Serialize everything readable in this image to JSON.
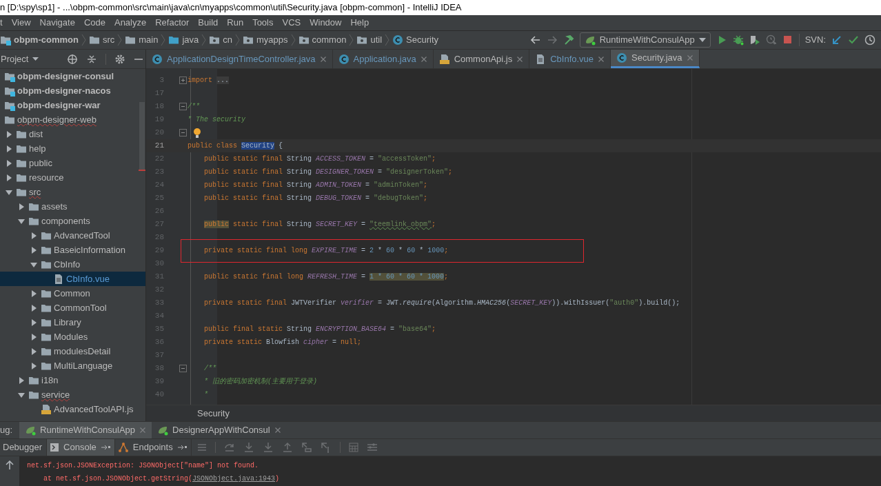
{
  "window": {
    "title": "n [D:\\spy\\sp1] - ...\\obpm-common\\src\\main\\java\\cn\\myapps\\common\\util\\Security.java [obpm-common] - IntelliJ IDEA"
  },
  "menu": [
    "t",
    "View",
    "Navigate",
    "Code",
    "Analyze",
    "Refactor",
    "Build",
    "Run",
    "Tools",
    "VCS",
    "Window",
    "Help"
  ],
  "breadcrumbs": [
    {
      "label": "obpm-common",
      "kind": "module"
    },
    {
      "label": "src",
      "kind": "folder"
    },
    {
      "label": "main",
      "kind": "folder"
    },
    {
      "label": "java",
      "kind": "source"
    },
    {
      "label": "cn",
      "kind": "package"
    },
    {
      "label": "myapps",
      "kind": "package"
    },
    {
      "label": "common",
      "kind": "package"
    },
    {
      "label": "util",
      "kind": "package"
    },
    {
      "label": "Security",
      "kind": "class"
    }
  ],
  "run_config": "RuntimeWithConsulApp",
  "svn_label": "SVN:",
  "project_panel": {
    "title": "Project",
    "tree": [
      {
        "label": "obpm-designer-consul",
        "kind": "module",
        "error": false,
        "selected": false
      },
      {
        "label": "obpm-designer-nacos",
        "kind": "module",
        "error": false,
        "selected": false
      },
      {
        "label": "obpm-designer-war",
        "kind": "module",
        "error": false,
        "selected": false
      },
      {
        "label": "obpm-designer-web",
        "kind": "folder",
        "error": true,
        "selected": false,
        "children": [
          {
            "label": "dist",
            "kind": "folder",
            "error": false,
            "selected": false,
            "expanded": false
          },
          {
            "label": "help",
            "kind": "folder",
            "error": false,
            "selected": false,
            "expanded": false
          },
          {
            "label": "public",
            "kind": "folder",
            "error": false,
            "selected": false,
            "expanded": false
          },
          {
            "label": "resource",
            "kind": "folder",
            "error": false,
            "selected": false,
            "expanded": false
          },
          {
            "label": "src",
            "kind": "folder",
            "error": true,
            "selected": false,
            "expanded": true,
            "children": [
              {
                "label": "assets",
                "kind": "folder",
                "error": false,
                "selected": false,
                "expanded": false
              },
              {
                "label": "components",
                "kind": "folder",
                "error": false,
                "selected": false,
                "expanded": true,
                "children": [
                  {
                    "label": "AdvancedTool",
                    "kind": "folder",
                    "error": false,
                    "selected": false,
                    "expanded": false
                  },
                  {
                    "label": "BaseicInformation",
                    "kind": "folder",
                    "error": false,
                    "selected": false,
                    "expanded": false
                  },
                  {
                    "label": "CbInfo",
                    "kind": "folder",
                    "error": false,
                    "selected": false,
                    "expanded": true,
                    "children": [
                      {
                        "label": "CbInfo.vue",
                        "kind": "vue",
                        "error": false,
                        "selected": true
                      }
                    ]
                  },
                  {
                    "label": "Common",
                    "kind": "folder",
                    "error": false,
                    "selected": false,
                    "expanded": false
                  },
                  {
                    "label": "CommonTool",
                    "kind": "folder",
                    "error": false,
                    "selected": false,
                    "expanded": false
                  },
                  {
                    "label": "Library",
                    "kind": "folder",
                    "error": false,
                    "selected": false,
                    "expanded": false
                  },
                  {
                    "label": "Modules",
                    "kind": "folder",
                    "error": false,
                    "selected": false,
                    "expanded": false
                  },
                  {
                    "label": "modulesDetail",
                    "kind": "folder",
                    "error": false,
                    "selected": false,
                    "expanded": false
                  },
                  {
                    "label": "MultiLanguage",
                    "kind": "folder",
                    "error": false,
                    "selected": false,
                    "expanded": false
                  }
                ]
              },
              {
                "label": "i18n",
                "kind": "folder",
                "error": false,
                "selected": false,
                "expanded": false
              },
              {
                "label": "service",
                "kind": "folder",
                "error": true,
                "selected": false,
                "expanded": true,
                "children": [
                  {
                    "label": "AdvancedToolAPI.js",
                    "kind": "js",
                    "error": false,
                    "selected": false
                  }
                ]
              }
            ]
          }
        ]
      }
    ]
  },
  "editor_tabs": [
    {
      "label": "ApplicationDesignTimeController.java",
      "kind": "class",
      "modified": true,
      "selected": false
    },
    {
      "label": "Application.java",
      "kind": "class",
      "modified": true,
      "selected": false
    },
    {
      "label": "CommonApi.js",
      "kind": "js",
      "modified": false,
      "selected": false
    },
    {
      "label": "CbInfo.vue",
      "kind": "file",
      "modified": true,
      "selected": false
    },
    {
      "label": "Security.java",
      "kind": "class",
      "modified": false,
      "selected": true
    }
  ],
  "code_lines": [
    {
      "number": "3",
      "fold_marker": true,
      "indented": false,
      "tokens": [
        {
          "text": "import",
          "kind": "kw"
        },
        {
          "text": "...",
          "kind": "folded"
        }
      ]
    },
    {
      "number": "17"
    },
    {
      "number": "18",
      "fold_marker": true,
      "indented": false,
      "tokens": [
        {
          "text": "/**",
          "kind": "comment"
        }
      ]
    },
    {
      "number": "19",
      "indented": false,
      "tokens": [
        {
          "text": "* The security",
          "kind": "comment"
        }
      ]
    },
    {
      "number": "20",
      "fold_marker": true,
      "bulb": true
    },
    {
      "number": "21",
      "indented": false,
      "current": true,
      "tokens": [
        {
          "text": "public class ",
          "kind": "kw"
        },
        {
          "text": "Security",
          "kind": "type",
          "selection": true
        },
        {
          "text": " {",
          "kind": "plain"
        }
      ]
    },
    {
      "number": "22",
      "indented": true,
      "tokens": [
        {
          "text": "public static final ",
          "kind": "kw"
        },
        {
          "text": "String ",
          "kind": "type"
        },
        {
          "text": "ACCESS_TOKEN",
          "kind": "field"
        },
        {
          "text": " = ",
          "kind": "plain"
        },
        {
          "text": "\"accessToken\"",
          "kind": "str"
        },
        {
          "text": ";",
          "kind": "kw"
        }
      ]
    },
    {
      "number": "23",
      "indented": true,
      "tokens": [
        {
          "text": "public static final ",
          "kind": "kw"
        },
        {
          "text": "String ",
          "kind": "type"
        },
        {
          "text": "DESIGNER_TOKEN",
          "kind": "field"
        },
        {
          "text": " = ",
          "kind": "plain"
        },
        {
          "text": "\"designerToken\"",
          "kind": "str"
        },
        {
          "text": ";",
          "kind": "kw"
        }
      ]
    },
    {
      "number": "24",
      "indented": true,
      "tokens": [
        {
          "text": "public static final ",
          "kind": "kw"
        },
        {
          "text": "String ",
          "kind": "type"
        },
        {
          "text": "ADMIN_TOKEN",
          "kind": "field"
        },
        {
          "text": " = ",
          "kind": "plain"
        },
        {
          "text": "\"adminToken\"",
          "kind": "str"
        },
        {
          "text": ";",
          "kind": "kw"
        }
      ]
    },
    {
      "number": "25",
      "indented": true,
      "tokens": [
        {
          "text": "public static final ",
          "kind": "kw"
        },
        {
          "text": "String ",
          "kind": "type"
        },
        {
          "text": "DEBUG_TOKEN",
          "kind": "field"
        },
        {
          "text": " = ",
          "kind": "plain"
        },
        {
          "text": "\"debugToken\"",
          "kind": "str"
        },
        {
          "text": ";",
          "kind": "kw"
        }
      ]
    },
    {
      "number": "26"
    },
    {
      "number": "27",
      "indented": true,
      "tokens": [
        {
          "text": "public",
          "kind": "kw",
          "usage": true
        },
        {
          "text": " static final ",
          "kind": "kw"
        },
        {
          "text": "String ",
          "kind": "type"
        },
        {
          "text": "SECRET_KEY",
          "kind": "field"
        },
        {
          "text": " = ",
          "kind": "plain"
        },
        {
          "text": "\"teemlink_obpm\"",
          "kind": "str",
          "typo": true
        },
        {
          "text": ";",
          "kind": "kw"
        }
      ]
    },
    {
      "number": "28"
    },
    {
      "number": "29",
      "indented": true,
      "boxed": true,
      "tokens": [
        {
          "text": "private static final long ",
          "kind": "kw"
        },
        {
          "text": "EXPIRE_TIME",
          "kind": "field"
        },
        {
          "text": " = ",
          "kind": "plain"
        },
        {
          "text": "2",
          "kind": "num"
        },
        {
          "text": " * ",
          "kind": "plain"
        },
        {
          "text": "60",
          "kind": "num"
        },
        {
          "text": " * ",
          "kind": "plain"
        },
        {
          "text": "60",
          "kind": "num"
        },
        {
          "text": " * ",
          "kind": "plain"
        },
        {
          "text": "1000",
          "kind": "num"
        },
        {
          "text": ";",
          "kind": "kw"
        }
      ]
    },
    {
      "number": "30"
    },
    {
      "number": "31",
      "indented": true,
      "tokens": [
        {
          "text": "public static final long ",
          "kind": "kw"
        },
        {
          "text": "REFRESH_TIME",
          "kind": "field"
        },
        {
          "text": " = ",
          "kind": "plain"
        },
        {
          "text": "1 * 60 * 60 * 1000",
          "kind": "num",
          "usage": true
        },
        {
          "text": ";",
          "kind": "kw"
        }
      ]
    },
    {
      "number": "32"
    },
    {
      "number": "33",
      "indented": true,
      "tokens": [
        {
          "text": "private static final ",
          "kind": "kw"
        },
        {
          "text": "JWTVerifier ",
          "kind": "type"
        },
        {
          "text": "verifier",
          "kind": "field"
        },
        {
          "text": " = JWT.",
          "kind": "plain"
        },
        {
          "text": "require",
          "kind": "method"
        },
        {
          "text": "(Algorithm.",
          "kind": "plain"
        },
        {
          "text": "HMAC256",
          "kind": "method"
        },
        {
          "text": "(",
          "kind": "plain"
        },
        {
          "text": "SECRET_KEY",
          "kind": "field"
        },
        {
          "text": ")).withIssuer(",
          "kind": "plain"
        },
        {
          "text": "\"auth0\"",
          "kind": "str"
        },
        {
          "text": ").build();",
          "kind": "plain"
        }
      ]
    },
    {
      "number": "34"
    },
    {
      "number": "35",
      "indented": true,
      "tokens": [
        {
          "text": "public final static ",
          "kind": "kw"
        },
        {
          "text": "String ",
          "kind": "type"
        },
        {
          "text": "ENCRYPTION_BASE64",
          "kind": "field"
        },
        {
          "text": " = ",
          "kind": "plain"
        },
        {
          "text": "\"base64\"",
          "kind": "str"
        },
        {
          "text": ";",
          "kind": "kw"
        }
      ]
    },
    {
      "number": "36",
      "indented": true,
      "tokens": [
        {
          "text": "private static ",
          "kind": "kw"
        },
        {
          "text": "Blowfish ",
          "kind": "type"
        },
        {
          "text": "cipher",
          "kind": "field"
        },
        {
          "text": " = ",
          "kind": "plain"
        },
        {
          "text": "null",
          "kind": "kw"
        },
        {
          "text": ";",
          "kind": "kw"
        }
      ]
    },
    {
      "number": "37"
    },
    {
      "number": "38",
      "fold_marker": true,
      "indented": true,
      "tokens": [
        {
          "text": "/**",
          "kind": "comment"
        }
      ]
    },
    {
      "number": "39",
      "indented": true,
      "tokens": [
        {
          "text": "* 旧的密码加密机制(主要用于登录)",
          "kind": "comment"
        }
      ]
    },
    {
      "number": "40",
      "indented": true,
      "tokens": [
        {
          "text": "*",
          "kind": "comment"
        }
      ]
    }
  ],
  "editor_breadcrumb": "Security",
  "debug": {
    "label": "ug:",
    "sessions": [
      {
        "label": "RuntimeWithConsulApp",
        "selected": true
      },
      {
        "label": "DesignerAppWithConsul",
        "selected": false
      }
    ],
    "views": [
      {
        "label": "Debugger",
        "kind": "debugger",
        "selected": false
      },
      {
        "label": "Console",
        "kind": "console",
        "selected": true
      },
      {
        "label": "Endpoints",
        "kind": "endpoints",
        "selected": false
      }
    ],
    "console_lines": [
      {
        "text": "net.sf.json.JSONException: JSONObject[\"name\"] not found."
      },
      {
        "text": "    at net.sf.json.JSONObject.getString(",
        "link": "JSONObject.java:1943",
        "suffix": ")"
      }
    ]
  }
}
